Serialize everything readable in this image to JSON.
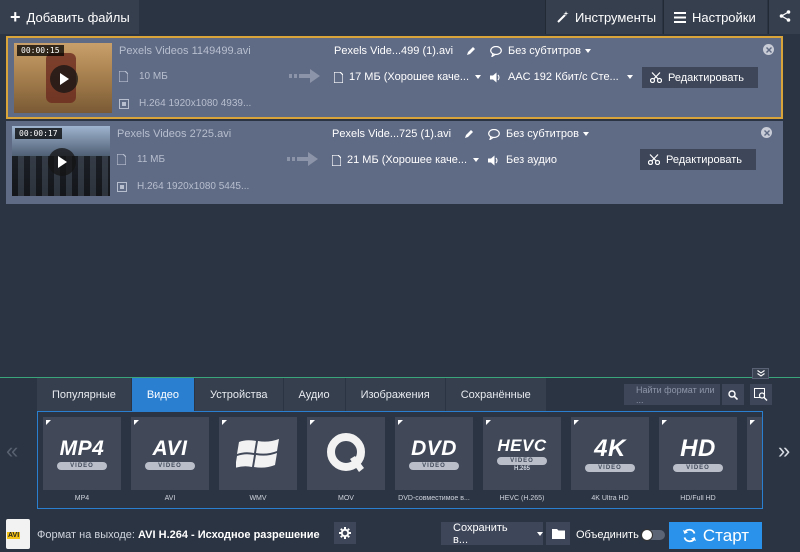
{
  "toolbar": {
    "add_files": "Добавить файлы",
    "tools": "Инструменты",
    "settings": "Настройки"
  },
  "files": [
    {
      "timecode": "00:00:15",
      "src_name": "Pexels Videos 1149499.avi",
      "src_size": "10 МБ",
      "src_codec": "H.264 1920x1080 4939...",
      "out_name": "Pexels Vide...499 (1).avi",
      "out_size": "17 МБ (Хорошее каче...",
      "subtitles": "Без субтитров",
      "audio": "AAC 192 Кбит/с Сте...",
      "edit": "Редактировать",
      "selected": true
    },
    {
      "timecode": "00:00:17",
      "src_name": "Pexels Videos 2725.avi",
      "src_size": "11 МБ",
      "src_codec": "H.264 1920x1080 5445...",
      "out_name": "Pexels Vide...725 (1).avi",
      "out_size": "21 МБ (Хорошее каче...",
      "subtitles": "Без субтитров",
      "audio": "Без аудио",
      "edit": "Редактировать",
      "selected": false
    }
  ],
  "tabs": [
    {
      "label": "Популярные",
      "active": false
    },
    {
      "label": "Видео",
      "active": true
    },
    {
      "label": "Устройства",
      "active": false
    },
    {
      "label": "Аудио",
      "active": false
    },
    {
      "label": "Изображения",
      "active": false
    },
    {
      "label": "Сохранённые",
      "active": false
    }
  ],
  "format_search": {
    "placeholder": "Найти формат или ..."
  },
  "formats": [
    {
      "label": "MP4",
      "logo": "MP4",
      "badge": "VIDEO"
    },
    {
      "label": "AVI",
      "logo": "AVI",
      "badge": "VIDEO"
    },
    {
      "label": "WMV",
      "logo": "windows-logo-icon",
      "badge": ""
    },
    {
      "label": "MOV",
      "logo": "quicktime-logo-icon",
      "badge": ""
    },
    {
      "label": "DVD-совместимое в...",
      "logo": "DVD",
      "badge": "VIDEO"
    },
    {
      "label": "HEVC (H.265)",
      "logo": "HEVC",
      "badge": "VIDEO",
      "sub": "H.265"
    },
    {
      "label": "4K Ultra HD",
      "logo": "4K",
      "badge": "VIDEO"
    },
    {
      "label": "HD/Full HD",
      "logo": "HD",
      "badge": "VIDEO"
    }
  ],
  "status": {
    "file_icon_text": "AVI",
    "format_prefix": "Формат на выходе:",
    "format_value": "AVI H.264 - Исходное разрешение",
    "save_to": "Сохранить в...",
    "merge": "Объединить",
    "start": "Старт"
  },
  "colors": {
    "accent": "#2a92ea",
    "selected_border": "#d9a43a",
    "row_bg": "#5f6a84"
  }
}
